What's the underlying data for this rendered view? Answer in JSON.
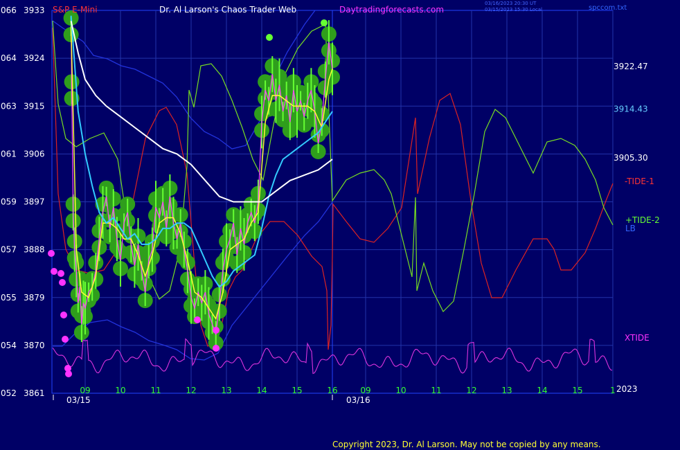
{
  "header": {
    "symbol": "S&P E-Mini",
    "title": "Dr. Al Larson's Chaos Trader Web",
    "site": "Daytradingforecasts.com",
    "timestamp_ut": "03/16/2023 20:30 UT",
    "timestamp_local": "03/15/2023 15:30 Local",
    "file": "spccom.txt"
  },
  "left_axis": {
    "codes": [
      "066",
      "064",
      "063",
      "061",
      "059",
      "057",
      "055",
      "054",
      "052"
    ],
    "prices": [
      3933,
      3924,
      3915,
      3906,
      3897,
      3888,
      3879,
      3870,
      3861
    ]
  },
  "right_labels": {
    "values": [
      {
        "text": "3922.47",
        "color": "#ffffff",
        "price": 3922.47
      },
      {
        "text": "3914.43",
        "color": "#66ccff",
        "price": 3914.43
      },
      {
        "text": "3905.30",
        "color": "#ffffff",
        "price": 3905.3
      }
    ],
    "series": [
      {
        "text": "-TIDE-1",
        "color": "#ff3333"
      },
      {
        "text": "+TIDE-2",
        "color": "#66ff33"
      },
      {
        "text": "LB",
        "color": "#3366ff"
      },
      {
        "text": "XTIDE",
        "color": "#ff33ff"
      }
    ]
  },
  "time_axis": {
    "hours": [
      "09",
      "10",
      "11",
      "12",
      "13",
      "14",
      "15",
      "16",
      "09",
      "10",
      "11",
      "12",
      "13",
      "14",
      "15",
      "1"
    ],
    "dates": [
      "03/15",
      "03/16"
    ],
    "year": "2023"
  },
  "copyright": "Copyright 2023, Dr. Al Larson. May not be copied by any means.",
  "colors": {
    "background": "#000066",
    "grid": "#2233aa",
    "axis": "#2244ff",
    "price": "#66ff33",
    "band": "#2f9e1c",
    "fast_ma": "#ffff33",
    "cyan_ma": "#33ccff",
    "white_ma": "#ffffff",
    "tide1": "#dd2222",
    "tide2": "#77dd22",
    "lb": "#2233dd",
    "xtide": "#dd33dd"
  },
  "chart_data": {
    "type": "line",
    "ylim": [
      3861,
      3933
    ],
    "x_unit": "hour",
    "series": [
      {
        "name": "S&P E-Mini",
        "kind": "price",
        "points": [
          [
            8.6,
            3930
          ],
          [
            8.62,
            3918
          ],
          [
            8.66,
            3895
          ],
          [
            8.7,
            3888
          ],
          [
            8.75,
            3884
          ],
          [
            8.8,
            3878
          ],
          [
            8.85,
            3881
          ],
          [
            8.9,
            3874
          ],
          [
            8.95,
            3878
          ],
          [
            9.0,
            3877
          ],
          [
            9.1,
            3880
          ],
          [
            9.2,
            3881
          ],
          [
            9.3,
            3884
          ],
          [
            9.4,
            3890
          ],
          [
            9.5,
            3895
          ],
          [
            9.6,
            3898
          ],
          [
            9.7,
            3892
          ],
          [
            9.8,
            3896
          ],
          [
            9.9,
            3890
          ],
          [
            10.0,
            3886
          ],
          [
            10.1,
            3893
          ],
          [
            10.2,
            3895
          ],
          [
            10.3,
            3889
          ],
          [
            10.4,
            3885
          ],
          [
            10.5,
            3889
          ],
          [
            10.6,
            3884
          ],
          [
            10.7,
            3880
          ],
          [
            10.8,
            3886
          ],
          [
            10.9,
            3888
          ],
          [
            11.0,
            3896
          ],
          [
            11.1,
            3894
          ],
          [
            11.2,
            3897
          ],
          [
            11.3,
            3892
          ],
          [
            11.4,
            3898
          ],
          [
            11.5,
            3893
          ],
          [
            11.6,
            3890
          ],
          [
            11.7,
            3893
          ],
          [
            11.8,
            3888
          ],
          [
            11.9,
            3884
          ],
          [
            12.0,
            3879
          ],
          [
            12.1,
            3877
          ],
          [
            12.2,
            3880
          ],
          [
            12.3,
            3878
          ],
          [
            12.4,
            3880
          ],
          [
            12.5,
            3876
          ],
          [
            12.6,
            3874
          ],
          [
            12.7,
            3872
          ],
          [
            12.8,
            3878
          ],
          [
            12.9,
            3884
          ],
          [
            13.0,
            3888
          ],
          [
            13.1,
            3890
          ],
          [
            13.2,
            3893
          ],
          [
            13.3,
            3887
          ],
          [
            13.4,
            3892
          ],
          [
            13.5,
            3889
          ],
          [
            13.6,
            3893
          ],
          [
            13.7,
            3895
          ],
          [
            13.8,
            3893
          ],
          [
            13.9,
            3897
          ],
          [
            14.0,
            3912
          ],
          [
            14.1,
            3918
          ],
          [
            14.2,
            3916
          ],
          [
            14.3,
            3921
          ],
          [
            14.4,
            3916
          ],
          [
            14.5,
            3919
          ],
          [
            14.6,
            3914
          ],
          [
            14.7,
            3917
          ],
          [
            14.8,
            3912
          ],
          [
            14.9,
            3918
          ],
          [
            15.0,
            3914
          ],
          [
            15.1,
            3916
          ],
          [
            15.2,
            3913
          ],
          [
            15.3,
            3916
          ],
          [
            15.4,
            3918
          ],
          [
            15.5,
            3914
          ],
          [
            15.6,
            3908
          ],
          [
            15.7,
            3912
          ],
          [
            15.8,
            3920
          ],
          [
            15.9,
            3927
          ],
          [
            16.0,
            3922
          ]
        ]
      },
      {
        "name": "yellow",
        "kind": "fast_ma",
        "points": [
          [
            8.6,
            3930
          ],
          [
            8.75,
            3888
          ],
          [
            8.9,
            3880
          ],
          [
            9.1,
            3879
          ],
          [
            9.3,
            3883
          ],
          [
            9.5,
            3893
          ],
          [
            9.7,
            3893
          ],
          [
            9.9,
            3892
          ],
          [
            10.1,
            3890
          ],
          [
            10.3,
            3890
          ],
          [
            10.5,
            3887
          ],
          [
            10.7,
            3883
          ],
          [
            10.9,
            3887
          ],
          [
            11.1,
            3893
          ],
          [
            11.3,
            3894
          ],
          [
            11.5,
            3894
          ],
          [
            11.7,
            3891
          ],
          [
            11.9,
            3886
          ],
          [
            12.1,
            3880
          ],
          [
            12.3,
            3879
          ],
          [
            12.5,
            3877
          ],
          [
            12.7,
            3875
          ],
          [
            12.9,
            3880
          ],
          [
            13.1,
            3888
          ],
          [
            13.3,
            3889
          ],
          [
            13.5,
            3890
          ],
          [
            13.7,
            3893
          ],
          [
            13.9,
            3895
          ],
          [
            14.1,
            3912
          ],
          [
            14.3,
            3917
          ],
          [
            14.5,
            3917
          ],
          [
            14.7,
            3916
          ],
          [
            14.9,
            3915
          ],
          [
            15.1,
            3915
          ],
          [
            15.3,
            3915
          ],
          [
            15.5,
            3914
          ],
          [
            15.7,
            3911
          ],
          [
            15.9,
            3920
          ],
          [
            16.0,
            3922
          ]
        ]
      },
      {
        "name": "cyan",
        "kind": "ma",
        "points": [
          [
            8.6,
            3932
          ],
          [
            8.8,
            3914
          ],
          [
            9.0,
            3906
          ],
          [
            9.2,
            3900
          ],
          [
            9.4,
            3895
          ],
          [
            9.6,
            3893
          ],
          [
            9.8,
            3894
          ],
          [
            10.0,
            3892
          ],
          [
            10.2,
            3890
          ],
          [
            10.4,
            3891
          ],
          [
            10.6,
            3889
          ],
          [
            10.8,
            3889
          ],
          [
            11.0,
            3890
          ],
          [
            11.2,
            3892
          ],
          [
            11.4,
            3892
          ],
          [
            11.6,
            3893
          ],
          [
            11.8,
            3893
          ],
          [
            12.0,
            3892
          ],
          [
            12.2,
            3889
          ],
          [
            12.4,
            3886
          ],
          [
            12.6,
            3883
          ],
          [
            12.8,
            3881
          ],
          [
            13.0,
            3882
          ],
          [
            13.2,
            3884
          ],
          [
            13.4,
            3885
          ],
          [
            13.6,
            3886
          ],
          [
            13.8,
            3887
          ],
          [
            14.0,
            3892
          ],
          [
            14.2,
            3898
          ],
          [
            14.4,
            3902
          ],
          [
            14.6,
            3905
          ],
          [
            14.8,
            3906
          ],
          [
            15.0,
            3907
          ],
          [
            15.2,
            3908
          ],
          [
            15.4,
            3909
          ],
          [
            15.6,
            3910
          ],
          [
            15.8,
            3912
          ],
          [
            16.0,
            3914
          ]
        ]
      },
      {
        "name": "white",
        "kind": "ma",
        "points": [
          [
            8.6,
            3931
          ],
          [
            8.8,
            3925
          ],
          [
            9.0,
            3920
          ],
          [
            9.3,
            3917
          ],
          [
            9.6,
            3915
          ],
          [
            10.0,
            3913
          ],
          [
            10.4,
            3911
          ],
          [
            10.8,
            3909
          ],
          [
            11.2,
            3907
          ],
          [
            11.6,
            3906
          ],
          [
            12.0,
            3904
          ],
          [
            12.4,
            3901
          ],
          [
            12.8,
            3898
          ],
          [
            13.2,
            3897
          ],
          [
            13.6,
            3897
          ],
          [
            14.0,
            3897
          ],
          [
            14.4,
            3899
          ],
          [
            14.8,
            3901
          ],
          [
            15.2,
            3902
          ],
          [
            15.6,
            3903
          ],
          [
            16.0,
            3905
          ]
        ]
      }
    ]
  }
}
